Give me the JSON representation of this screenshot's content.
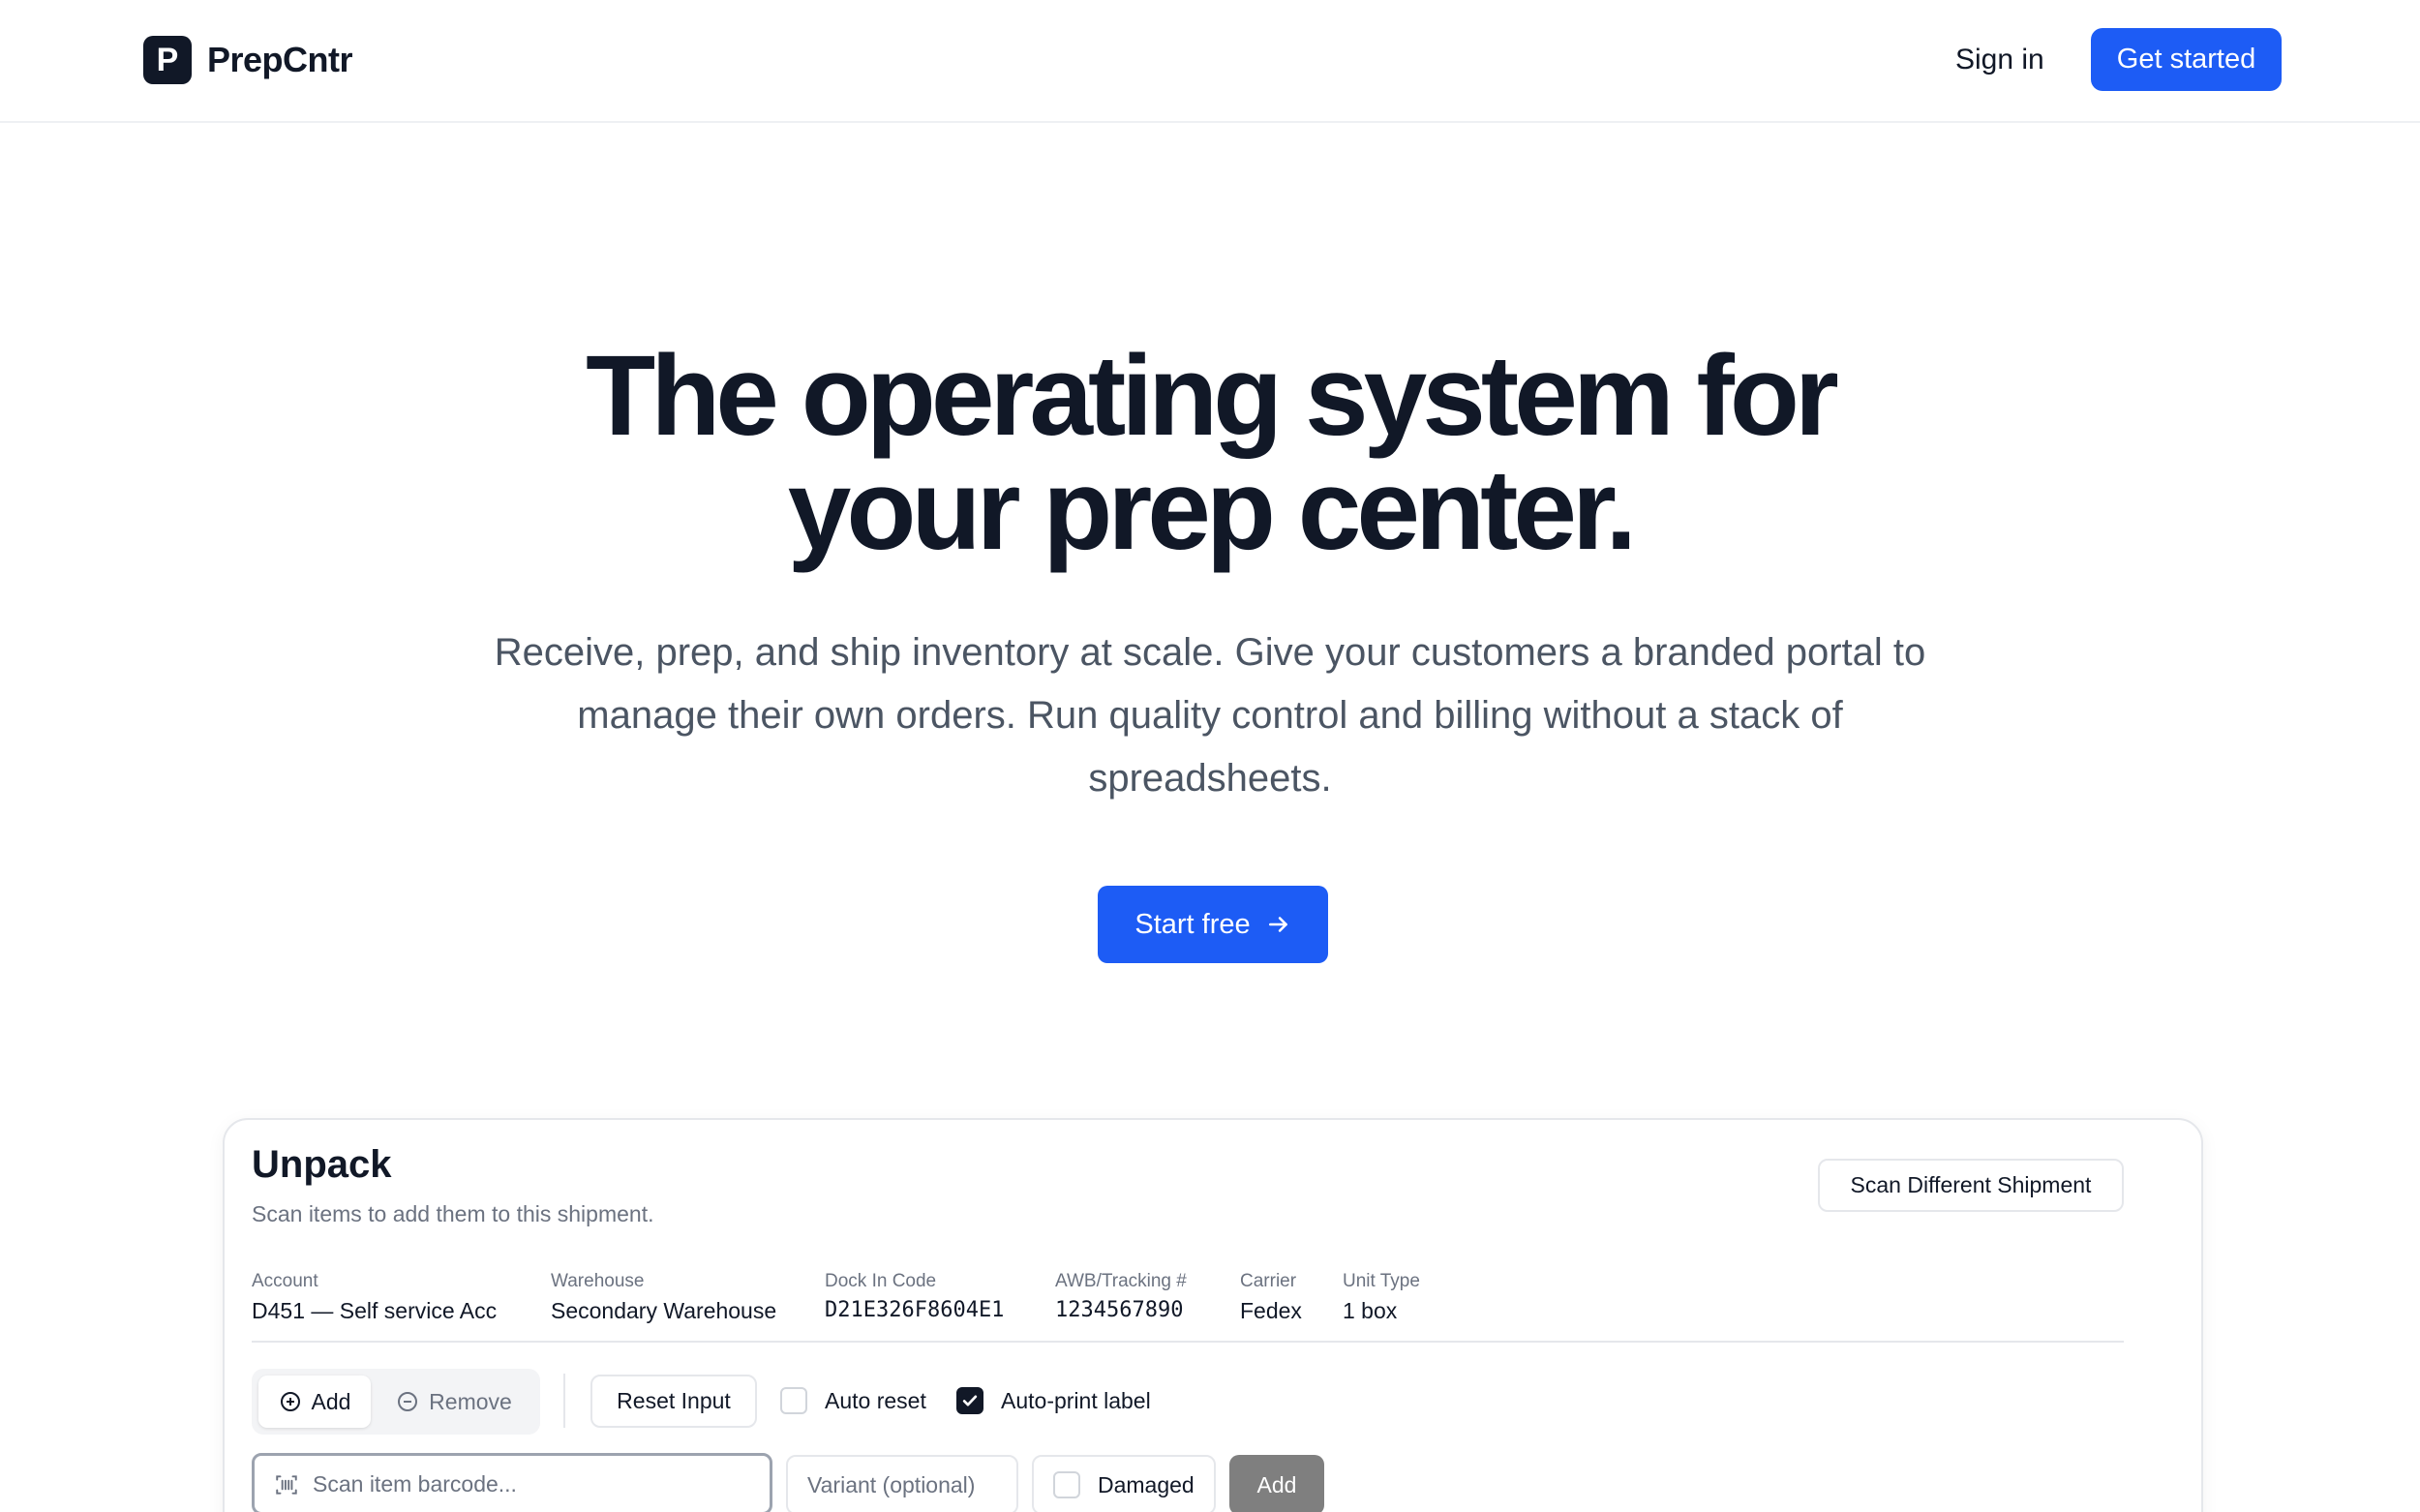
{
  "header": {
    "logo_letter": "P",
    "brand": "PrepCntr",
    "signin_label": "Sign in",
    "getstarted_label": "Get started"
  },
  "hero": {
    "headline_line1": "The operating system for",
    "headline_line2": "your prep center.",
    "subtext": "Receive, prep, and ship inventory at scale. Give your customers a branded portal to manage their own orders. Run quality control and billing without a stack of spreadsheets.",
    "cta_label": "Start free"
  },
  "card": {
    "title": "Unpack",
    "subtitle": "Scan items to add them to this shipment.",
    "scan_different_label": "Scan Different Shipment",
    "meta": [
      {
        "label": "Account",
        "value": "D451 — Self service Acc"
      },
      {
        "label": "Warehouse",
        "value": "Secondary Warehouse"
      },
      {
        "label": "Dock In Code",
        "value": "D21E326F8604E1"
      },
      {
        "label": "AWB/Tracking #",
        "value": "1234567890"
      },
      {
        "label": "Carrier",
        "value": "Fedex"
      },
      {
        "label": "Unit Type",
        "value": "1 box"
      }
    ],
    "mode_add_label": "Add",
    "mode_remove_label": "Remove",
    "reset_label": "Reset Input",
    "auto_reset_label": "Auto reset",
    "auto_reset_checked": false,
    "auto_print_label": "Auto-print label",
    "auto_print_checked": true,
    "barcode_placeholder": "Scan item barcode...",
    "barcode_value": "",
    "variant_placeholder": "Variant (optional)",
    "variant_value": "",
    "damaged_label": "Damaged",
    "damaged_checked": false,
    "add_button_label": "Add"
  },
  "colors": {
    "primary": "#1d5cf5",
    "text_dark": "#111827",
    "text_muted": "#6b7280",
    "border": "#e5e7eb",
    "disabled_button": "#7f7f7f"
  }
}
